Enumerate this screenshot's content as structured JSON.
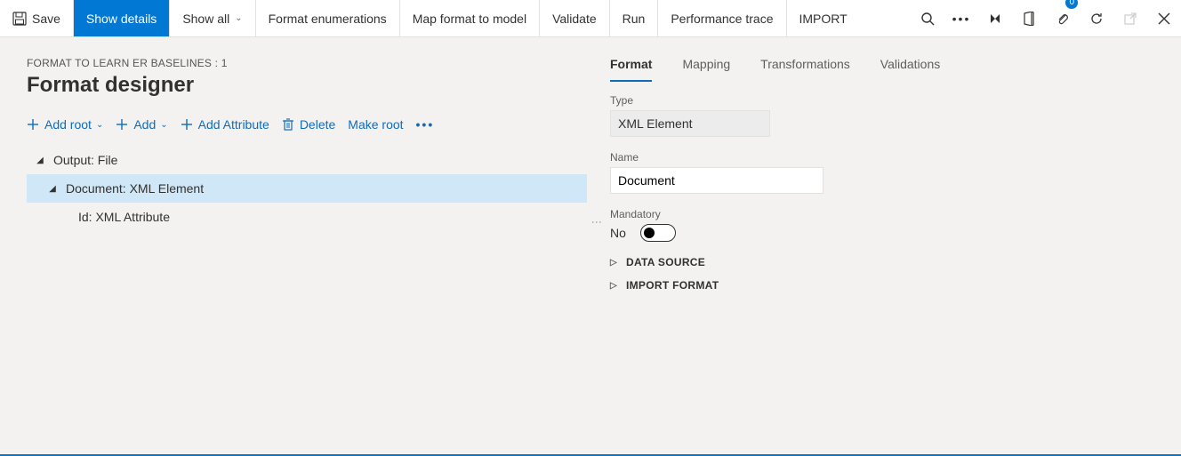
{
  "toolbar": {
    "save": "Save",
    "show_details": "Show details",
    "show_all": "Show all",
    "format_enumerations": "Format enumerations",
    "map_format": "Map format to model",
    "validate": "Validate",
    "run": "Run",
    "perf_trace": "Performance trace",
    "import": "IMPORT"
  },
  "header": {
    "breadcrumb": "FORMAT TO LEARN ER BASELINES : 1",
    "title": "Format designer"
  },
  "actions": {
    "add_root": "Add root",
    "add": "Add",
    "add_attribute": "Add Attribute",
    "delete": "Delete",
    "make_root": "Make root"
  },
  "tree": {
    "node0": "Output: File",
    "node1": "Document: XML Element",
    "node2": "Id: XML Attribute"
  },
  "tabs": {
    "format": "Format",
    "mapping": "Mapping",
    "transformations": "Transformations",
    "validations": "Validations"
  },
  "form": {
    "type_label": "Type",
    "type_value": "XML Element",
    "name_label": "Name",
    "name_value": "Document",
    "mandatory_label": "Mandatory",
    "mandatory_value": "No"
  },
  "expanders": {
    "data_source": "DATA SOURCE",
    "import_format": "IMPORT FORMAT"
  },
  "badge": {
    "count": "0"
  }
}
